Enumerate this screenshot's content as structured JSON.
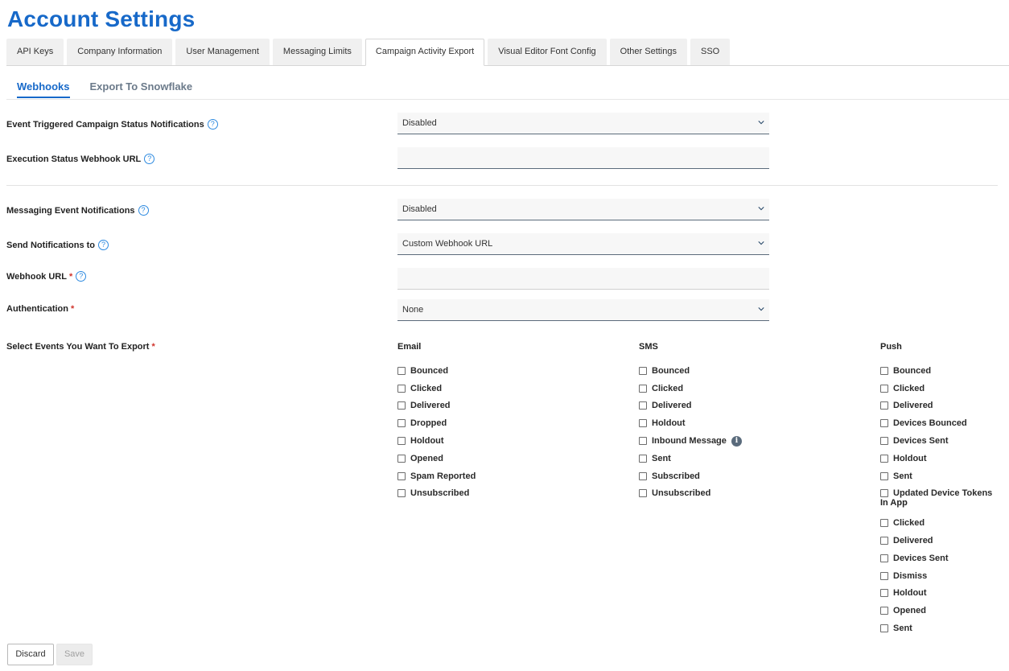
{
  "page_title": "Account Settings",
  "tabs": [
    {
      "label": "API Keys",
      "active": false
    },
    {
      "label": "Company Information",
      "active": false
    },
    {
      "label": "User Management",
      "active": false
    },
    {
      "label": "Messaging Limits",
      "active": false
    },
    {
      "label": "Campaign Activity Export",
      "active": true
    },
    {
      "label": "Visual Editor Font Config",
      "active": false
    },
    {
      "label": "Other Settings",
      "active": false
    },
    {
      "label": "SSO",
      "active": false
    }
  ],
  "subtabs": [
    {
      "label": "Webhooks",
      "active": true
    },
    {
      "label": "Export To Snowflake",
      "active": false
    }
  ],
  "form": {
    "event_triggered": {
      "label": "Event Triggered Campaign Status Notifications",
      "value": "Disabled"
    },
    "execution_webhook": {
      "label": "Execution Status Webhook URL",
      "value": ""
    },
    "messaging_event": {
      "label": "Messaging Event Notifications",
      "value": "Disabled"
    },
    "send_to": {
      "label": "Send Notifications to",
      "value": "Custom Webhook URL"
    },
    "webhook_url": {
      "label": "Webhook URL",
      "value": ""
    },
    "authentication": {
      "label": "Authentication",
      "value": "None"
    },
    "select_events": {
      "label": "Select Events You Want To Export"
    }
  },
  "help_glyph": "?",
  "required_mark": "*",
  "info_glyph": "i",
  "events": {
    "email": {
      "title": "Email",
      "items": [
        "Bounced",
        "Clicked",
        "Delivered",
        "Dropped",
        "Holdout",
        "Opened",
        "Spam Reported",
        "Unsubscribed"
      ]
    },
    "sms": {
      "title": "SMS",
      "items": [
        "Bounced",
        "Clicked",
        "Delivered",
        "Holdout",
        "Inbound Message",
        "Sent",
        "Subscribed",
        "Unsubscribed"
      ]
    },
    "push": {
      "title": "Push",
      "items": [
        "Bounced",
        "Clicked",
        "Delivered",
        "Devices Bounced",
        "Devices Sent",
        "Holdout",
        "Sent",
        "Updated Device Tokens"
      ]
    },
    "in_app": {
      "title": "In App",
      "items": [
        "Clicked",
        "Delivered",
        "Devices Sent",
        "Dismiss",
        "Holdout",
        "Opened",
        "Sent"
      ]
    }
  },
  "buttons": {
    "discard": "Discard",
    "save": "Save"
  },
  "colors": {
    "accent": "#1769c9",
    "required": "#d0342c"
  }
}
